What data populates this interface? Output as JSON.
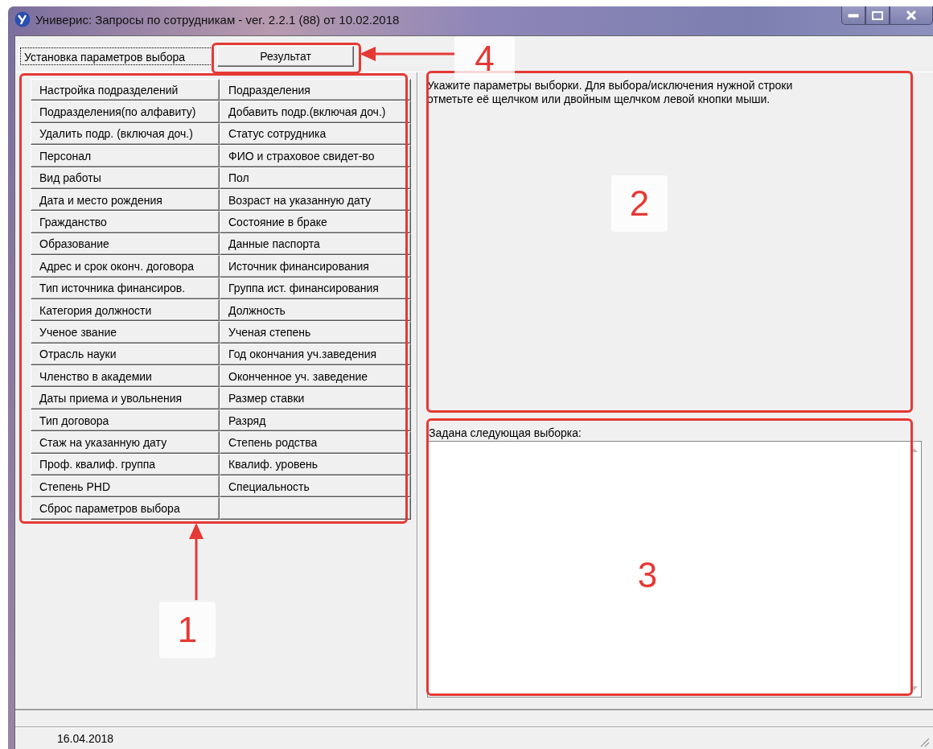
{
  "window": {
    "title": "Универис: Запросы по сотрудникам  -  ver. 2.2.1 (88) от 10.02.2018"
  },
  "tabs": [
    {
      "label": "Установка параметров выбора",
      "selected": true
    },
    {
      "label": "Результат",
      "selected": false
    }
  ],
  "parameter_buttons": [
    "Настройка подразделений",
    "Подразделения",
    "Подразделения(по алфавиту)",
    "Добавить подр.(включая доч.)",
    "Удалить подр. (включая доч.)",
    "Статус сотрудника",
    "Персонал",
    "ФИО и страховое свидет-во",
    "Вид работы",
    "Пол",
    "Дата и место рождения",
    "Возраст на указанную дату",
    "Гражданство",
    "Состояние в браке",
    "Образование",
    "Данные паспорта",
    "Адрес и срок оконч. договора",
    "Источник финансирования",
    "Тип источника финансиров.",
    "Группа ист. финансирования",
    "Категория должности",
    "Должность",
    "Ученое звание",
    "Ученая степень",
    "Отрасль науки",
    "Год окончания уч.заведения",
    "Членство в академии",
    "Оконченное уч. заведение",
    "Даты приема и увольнения",
    "Размер ставки",
    "Тип договора",
    "Разряд",
    "Стаж на указанную дату",
    "Степень родства",
    "Проф. квалиф. группа",
    "Квалиф. уровень",
    "Степень PHD",
    "Специальность",
    "Сброс параметров выбора"
  ],
  "instructions": "Укажите параметры выборки. Для выбора/исключения нужной строки отметьте её щелчком или двойным щелчком левой кнопки мыши.",
  "selection": {
    "label": "Задана следующая выборка:"
  },
  "status_bar": {
    "date": "16.04.2018"
  },
  "annotations": [
    {
      "label": "1",
      "kind": "boxed"
    },
    {
      "label": "2",
      "kind": "boxed"
    },
    {
      "label": "3",
      "kind": "plain"
    },
    {
      "label": "4",
      "kind": "boxed"
    }
  ]
}
